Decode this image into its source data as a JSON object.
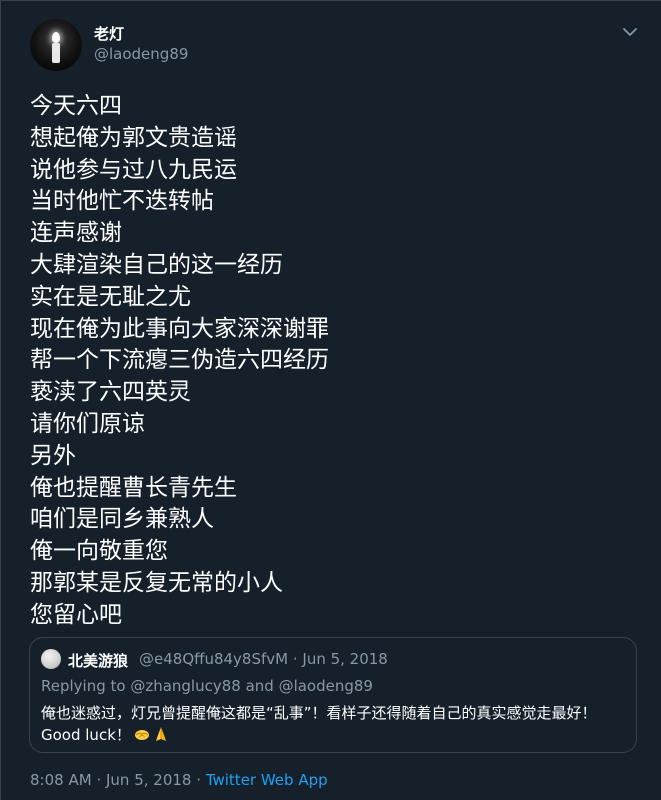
{
  "tweet": {
    "display_name": "老灯",
    "handle": "@laodeng89",
    "lines": [
      "今天六四",
      "想起俺为郭文贵造谣",
      "说他参与过八九民运",
      "当时他忙不迭转帖",
      "连声感谢",
      "大肆渲染自己的这一经历",
      "实在是无耻之尤",
      "现在俺为此事向大家深深谢罪",
      "帮一个下流瘪三伪造六四经历",
      "亵渎了六四英灵",
      "请你们原谅",
      "另外",
      "俺也提醒曹长青先生",
      "咱们是同乡兼熟人",
      "俺一向敬重您",
      "那郭某是反复无常的小人",
      "您留心吧"
    ],
    "time": "8:08 AM",
    "separator": "·",
    "date": "Jun 5, 2018",
    "app": "Twitter Web App"
  },
  "quoted": {
    "display_name": "北美游狼",
    "handle_date": "@e48Qffu84y8SfvM · Jun 5, 2018",
    "replying_to": "Replying to @zhanglucy88 and @laodeng89",
    "text": "俺也迷惑过，灯兄曾提醒俺这都是“乱事”！看样子还得随着自己的真实感觉走最好！Good luck！",
    "emojis": [
      "handshake-icon",
      "folded-hands-icon"
    ]
  },
  "colors": {
    "background": "#15202b",
    "text": "#ffffff",
    "secondary": "#8899a6",
    "link": "#1da1f2",
    "border": "#38444d"
  }
}
